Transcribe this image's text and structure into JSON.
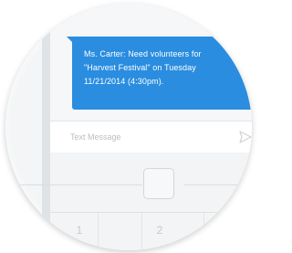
{
  "message": {
    "text_line1": "Ms. Carter:  Need volunteers for",
    "text_line2": "\"Harvest Festival\" on Tuesday",
    "text_line3": "11/21/2014 (4:30pm).",
    "bubble_color": "#2a8de0"
  },
  "composer": {
    "placeholder": "Text Message",
    "send_icon": "send-icon"
  },
  "keypad": {
    "keys": [
      "1",
      "2"
    ]
  },
  "device": {
    "home_button_icon": "home-button"
  }
}
